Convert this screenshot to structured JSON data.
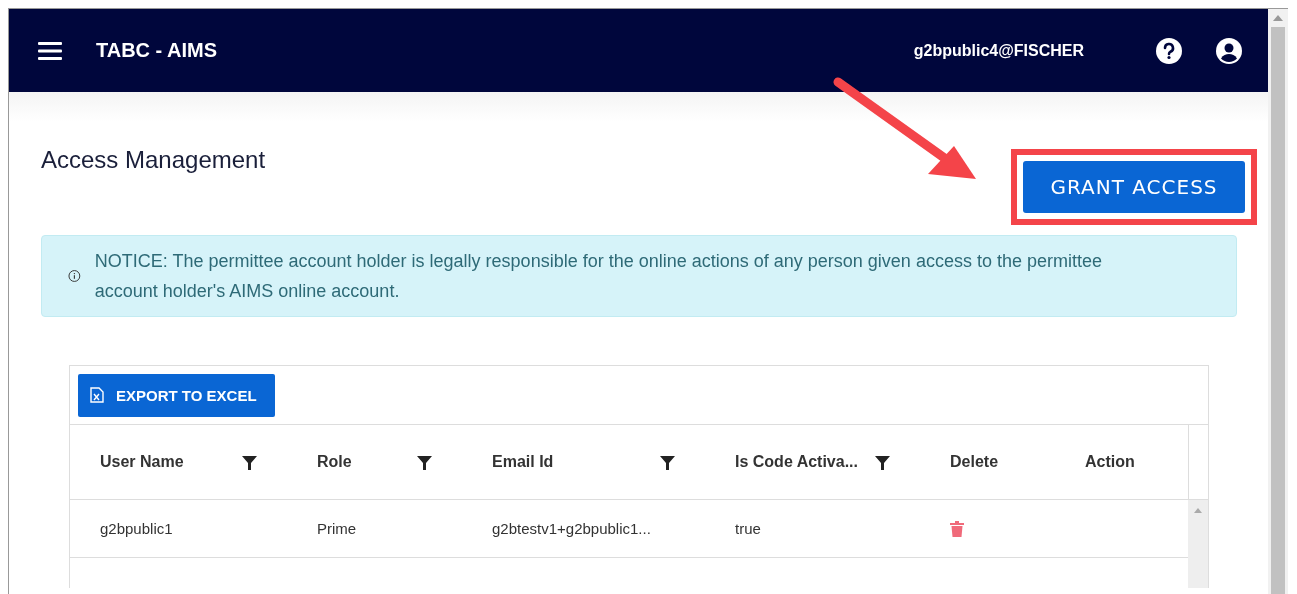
{
  "navbar": {
    "title": "TABC - AIMS",
    "user": "g2bpublic4@FISCHER"
  },
  "page": {
    "title": "Access Management",
    "grant_button": "GRANT ACCESS"
  },
  "notice": {
    "text": "NOTICE: The permittee account holder is legally responsible for the online actions of any person given access to the permittee account holder's AIMS online account."
  },
  "table": {
    "export_button": "EXPORT TO EXCEL",
    "columns": [
      {
        "label": "User Name",
        "kind": "filter"
      },
      {
        "label": "Role",
        "kind": "filter"
      },
      {
        "label": "Email Id",
        "kind": "filter"
      },
      {
        "label": "Is Code Activa...",
        "kind": "filter"
      },
      {
        "label": "Delete",
        "kind": "plain"
      },
      {
        "label": "Action",
        "kind": "plain"
      }
    ],
    "rows": [
      {
        "user_name": "g2bpublic1",
        "role": "Prime",
        "email": "g2btestv1+g2bpublic1...",
        "is_code_activated": "true"
      }
    ]
  }
}
